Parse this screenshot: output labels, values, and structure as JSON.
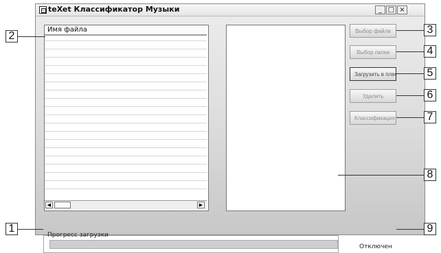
{
  "window": {
    "title": "teXet Классификатор Музыки",
    "controls": {
      "minimize": "_",
      "maximize": "□",
      "close": "×"
    }
  },
  "left_list": {
    "header": "Имя файла"
  },
  "scrollbar": {
    "left_arrow": "◀",
    "right_arrow": "▶"
  },
  "buttons": {
    "choose_file": "Выбор файла",
    "choose_folder": "Выбор папки",
    "load_player": "Загрузить в плее",
    "delete": "Удалить",
    "classification": "Классификация"
  },
  "progress": {
    "label": "Прогресс загрузки"
  },
  "status": {
    "text": "Отключен"
  },
  "callouts": {
    "c1": "1",
    "c2": "2",
    "c3": "3",
    "c4": "4",
    "c5": "5",
    "c6": "6",
    "c7": "7",
    "c8": "8",
    "c9": "9"
  },
  "colors": {
    "window_bg": "#dcdcdc",
    "accent_disabled": "#8c8c8c",
    "accent_active": "#454545"
  },
  "icons": {
    "app": "app-icon",
    "minimize": "minimize-icon",
    "maximize": "maximize-icon",
    "close": "close-icon",
    "scroll_left": "scroll-left-icon",
    "scroll_right": "scroll-right-icon"
  }
}
